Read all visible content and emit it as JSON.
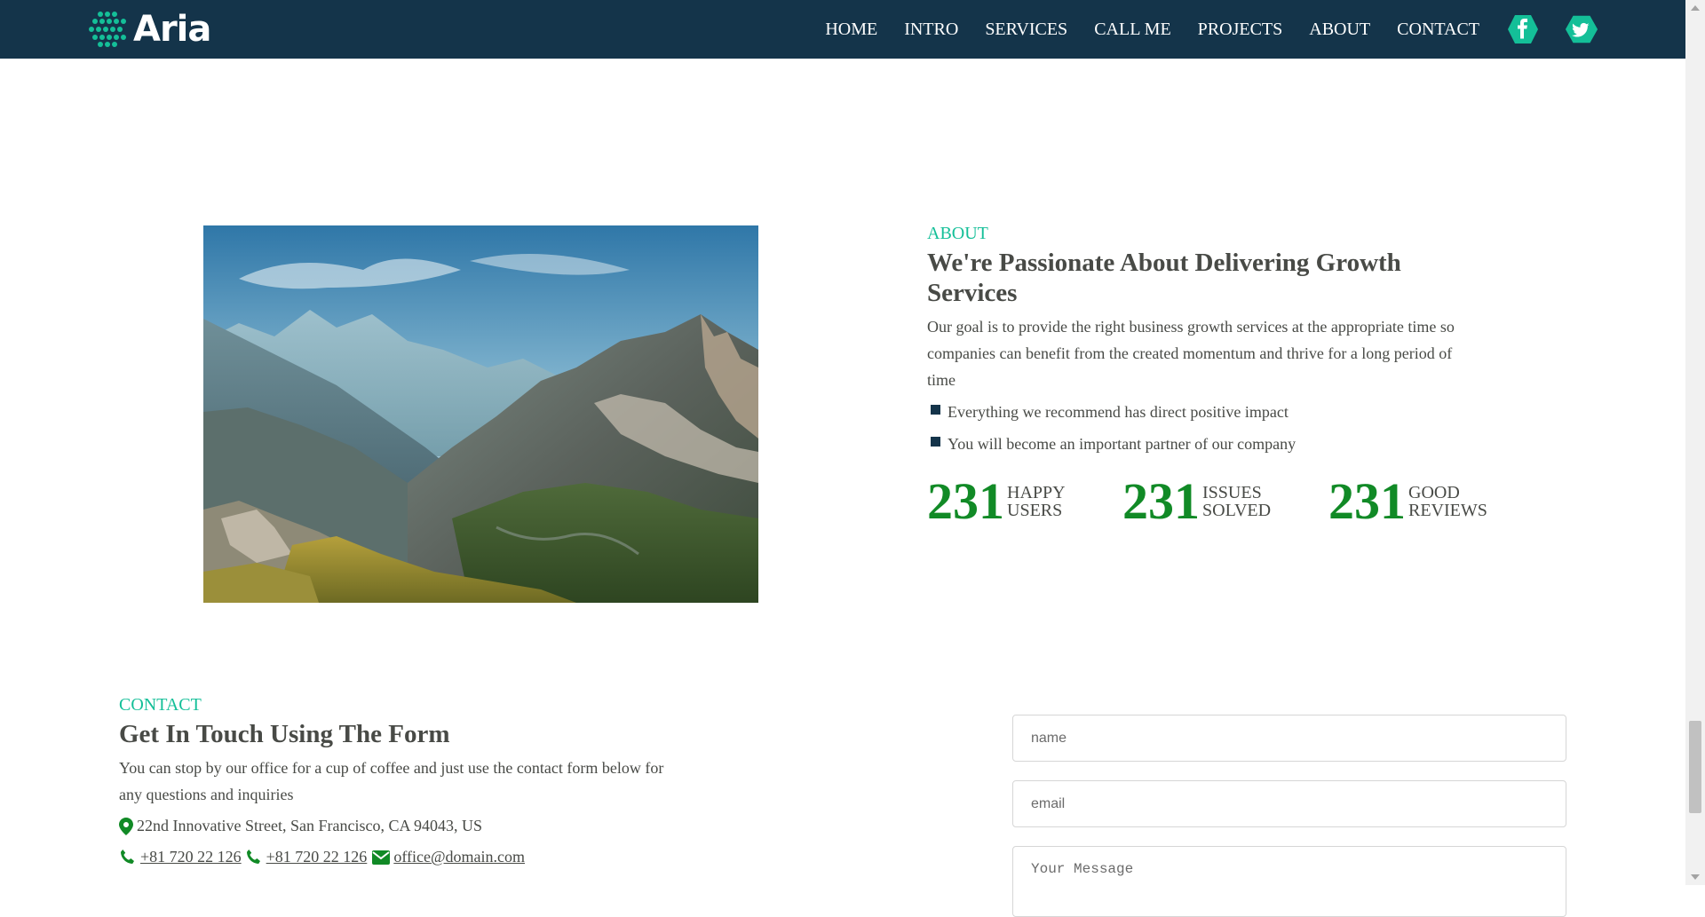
{
  "brand": {
    "name": "Aria"
  },
  "nav": {
    "links": [
      "HOME",
      "INTRO",
      "SERVICES",
      "CALL ME",
      "PROJECTS",
      "ABOUT",
      "CONTACT"
    ],
    "social": [
      "facebook-icon",
      "twitter-icon"
    ]
  },
  "about": {
    "eyebrow": "ABOUT",
    "heading": "We're Passionate About Delivering Growth Services",
    "paragraph": "Our goal is to provide the right business growth services at the appropriate time so companies can benefit from the created momentum and thrive for a long period of time",
    "bullets": [
      "Everything we recommend has direct positive impact",
      "You will become an important partner of our company"
    ],
    "counters": [
      {
        "value": "231",
        "label_1": "HAPPY",
        "label_2": "USERS"
      },
      {
        "value": "231",
        "label_1": "ISSUES",
        "label_2": "SOLVED"
      },
      {
        "value": "231",
        "label_1": "GOOD",
        "label_2": "REVIEWS"
      }
    ]
  },
  "contact": {
    "eyebrow": "CONTACT",
    "heading": "Get In Touch Using The Form",
    "paragraph": "You can stop by our office for a cup of coffee and just use the contact form below for any questions and inquiries",
    "address": "22nd Innovative Street, San Francisco, CA 94043, US",
    "phone_1": "+81 720 22 126",
    "phone_2": "+81 720 22 126",
    "email": "office@domain.com",
    "form": {
      "name_placeholder": "name",
      "email_placeholder": "email",
      "message_placeholder": "Your Message"
    }
  },
  "colors": {
    "navbar": "#14344a",
    "accent_teal": "#14bf98",
    "counter_green": "#118a26",
    "text": "#484a46"
  }
}
